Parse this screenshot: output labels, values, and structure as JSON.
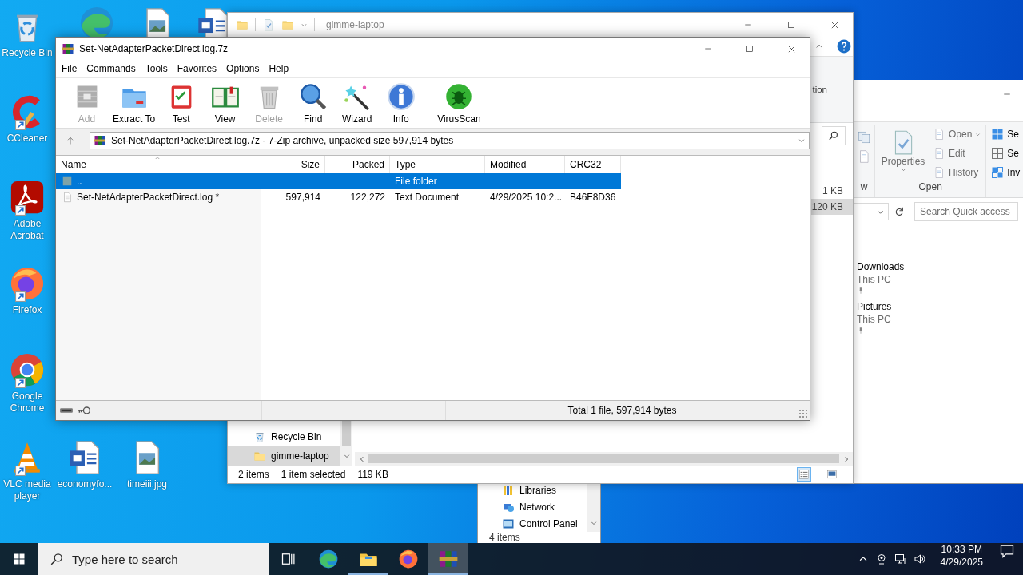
{
  "desktop_icons": [
    {
      "label": "Recycle Bin",
      "kind": "recycle",
      "shortcut": false
    },
    {
      "kind": "edge",
      "shortcut": false
    },
    {
      "kind": "image",
      "shortcut": false
    },
    {
      "kind": "word",
      "shortcut": false
    },
    {
      "label": "CCleaner",
      "kind": "ccleaner",
      "shortcut": true
    },
    {
      "label": "Adobe Acrobat",
      "kind": "acrobat",
      "shortcut": true
    },
    {
      "label": "Firefox",
      "kind": "firefox",
      "shortcut": true
    },
    {
      "label": "Google Chrome",
      "kind": "chrome",
      "shortcut": true
    },
    {
      "label": "VLC media player",
      "kind": "vlc",
      "shortcut": true
    },
    {
      "label": "economyfo...",
      "kind": "word",
      "shortcut": false
    },
    {
      "label": "timeiii.jpg",
      "kind": "image",
      "shortcut": false
    }
  ],
  "explorer_back": {
    "nav": [
      {
        "label": "Libraries",
        "kind": "libraries"
      },
      {
        "label": "Network",
        "kind": "network"
      },
      {
        "label": "Control Panel",
        "kind": "control"
      }
    ],
    "status": "4 items"
  },
  "explorer_side": {
    "ribbon": {
      "groups": [
        {
          "label": "w",
          "kind": "clipboard"
        },
        {
          "label": "Open",
          "kind": "open",
          "large": {
            "label": "Properties",
            "disabled": true
          },
          "small": [
            {
              "label": "Open",
              "dropdown": true,
              "disabled": true
            },
            {
              "label": "Edit",
              "dropdown": false,
              "disabled": true
            },
            {
              "label": "History",
              "dropdown": false,
              "disabled": true
            }
          ]
        },
        {
          "kind": "select",
          "small": [
            {
              "label": "Se",
              "dropdown": false,
              "disabled": false
            },
            {
              "label": "Se",
              "dropdown": false,
              "disabled": false
            },
            {
              "label": "Inv",
              "dropdown": false,
              "disabled": false
            }
          ]
        }
      ]
    },
    "search": {
      "placeholder": "Search Quick access"
    },
    "quick_access": [
      {
        "name": "Downloads",
        "location": "This PC",
        "pinned": true
      },
      {
        "name": "Pictures",
        "location": "This PC",
        "pinned": true
      }
    ]
  },
  "explorer_main": {
    "title": "gimme-laptop",
    "ribbon_label": "tion",
    "rows": [
      {
        "size": "1 KB",
        "selected": false
      },
      {
        "size": "120 KB",
        "selected": true
      }
    ],
    "nav": [
      {
        "label": "Recycle Bin",
        "kind": "recycle",
        "selected": false
      },
      {
        "label": "gimme-laptop",
        "kind": "folder",
        "selected": true
      }
    ],
    "status": {
      "count": "2 items",
      "selection": "1 item selected",
      "size": "119 KB"
    },
    "views": [
      {
        "kind": "details",
        "selected": true
      },
      {
        "kind": "thumbnails",
        "selected": false
      }
    ]
  },
  "zip": {
    "title": "Set-NetAdapterPacketDirect.log.7z",
    "menu": [
      "File",
      "Commands",
      "Tools",
      "Favorites",
      "Options",
      "Help"
    ],
    "toolbar": [
      {
        "label": "Add",
        "kind": "add",
        "disabled": true
      },
      {
        "label": "Extract To",
        "kind": "extract",
        "disabled": false
      },
      {
        "label": "Test",
        "kind": "test",
        "disabled": false
      },
      {
        "label": "View",
        "kind": "view",
        "disabled": false
      },
      {
        "label": "Delete",
        "kind": "delete",
        "disabled": true
      },
      {
        "label": "Find",
        "kind": "find",
        "disabled": false
      },
      {
        "label": "Wizard",
        "kind": "wizard",
        "disabled": false
      },
      {
        "label": "Info",
        "kind": "info",
        "disabled": false
      },
      {
        "label": "VirusScan",
        "kind": "virus",
        "disabled": false
      }
    ],
    "path": "Set-NetAdapterPacketDirect.log.7z - 7-Zip archive, unpacked size 597,914 bytes",
    "columns": [
      "Name",
      "Size",
      "Packed",
      "Type",
      "Modified",
      "CRC32"
    ],
    "rows": [
      {
        "kind": "folder",
        "name": "..",
        "type": "File folder",
        "selected": true
      },
      {
        "kind": "file",
        "name": "Set-NetAdapterPacketDirect.log *",
        "size": "597,914",
        "packed": "122,272",
        "type": "Text Document",
        "modified": "4/29/2025 10:2...",
        "crc32": "B46F8D36",
        "selected": false
      }
    ],
    "status": "Total 1 file, 597,914 bytes"
  },
  "taskbar": {
    "search": {
      "placeholder": "Type here to search"
    },
    "apps": [
      {
        "kind": "taskview",
        "running": false,
        "active": false
      },
      {
        "kind": "edge",
        "running": false,
        "active": false
      },
      {
        "kind": "explorer",
        "running": true,
        "active": false
      },
      {
        "kind": "firefox",
        "running": false,
        "active": false
      },
      {
        "kind": "archiver",
        "running": true,
        "active": true
      }
    ],
    "clock": {
      "time": "10:33 PM",
      "date": "4/29/2025"
    }
  }
}
